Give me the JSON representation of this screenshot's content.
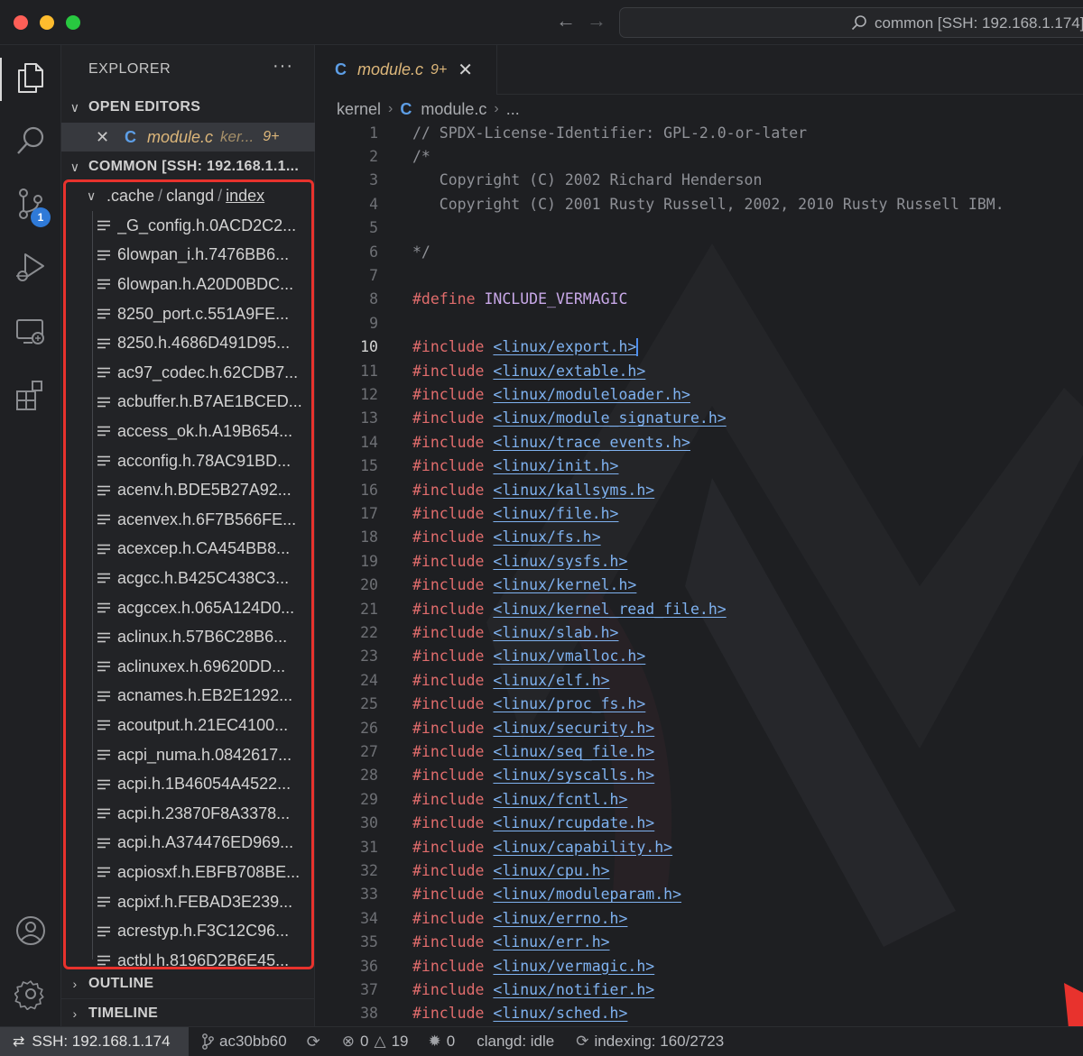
{
  "window": {
    "command_center_text": "common [SSH: 192.168.1.174]"
  },
  "activity_bar": {
    "source_control_badge": "1"
  },
  "sidebar": {
    "title": "EXPLORER",
    "more_label": "···",
    "open_editors_header": "OPEN EDITORS",
    "open_editor": {
      "name": "module.c",
      "path": "ker...",
      "badge": "9+"
    },
    "workspace_header": "COMMON [SSH: 192.168.1.1...",
    "folder_path": [
      ".cache",
      "clangd",
      "index"
    ],
    "files": [
      "_G_config.h.0ACD2C2...",
      "6lowpan_i.h.7476BB6...",
      "6lowpan.h.A20D0BDC...",
      "8250_port.c.551A9FE...",
      "8250.h.4686D491D95...",
      "ac97_codec.h.62CDB7...",
      "acbuffer.h.B7AE1BCED...",
      "access_ok.h.A19B654...",
      "acconfig.h.78AC91BD...",
      "acenv.h.BDE5B27A92...",
      "acenvex.h.6F7B566FE...",
      "acexcep.h.CA454BB8...",
      "acgcc.h.B425C438C3...",
      "acgccex.h.065A124D0...",
      "aclinux.h.57B6C28B6...",
      "aclinuxex.h.69620DD...",
      "acnames.h.EB2E1292...",
      "acoutput.h.21EC4100...",
      "acpi_numa.h.0842617...",
      "acpi.h.1B46054A4522...",
      "acpi.h.23870F8A3378...",
      "acpi.h.A374476ED969...",
      "acpiosxf.h.EBFB708BE...",
      "acpixf.h.FEBAD3E239...",
      "acrestyp.h.F3C12C96...",
      "actbl.h.8196D2B6E45..."
    ],
    "outline_header": "OUTLINE",
    "timeline_header": "TIMELINE"
  },
  "editor": {
    "tab": {
      "name": "module.c",
      "badge": "9+"
    },
    "breadcrumbs": [
      "kernel",
      "module.c",
      "..."
    ],
    "current_line": 10,
    "lines": [
      {
        "n": "1",
        "type": "comment",
        "text": "// SPDX-License-Identifier: GPL-2.0-or-later"
      },
      {
        "n": "2",
        "type": "comment",
        "text": "/*"
      },
      {
        "n": "3",
        "type": "comment",
        "text": "   Copyright (C) 2002 Richard Henderson"
      },
      {
        "n": "4",
        "type": "comment",
        "text": "   Copyright (C) 2001 Rusty Russell, 2002, 2010 Rusty Russell IBM."
      },
      {
        "n": "5",
        "type": "comment",
        "text": ""
      },
      {
        "n": "6",
        "type": "comment",
        "text": "*/"
      },
      {
        "n": "7",
        "type": "blank",
        "text": ""
      },
      {
        "n": "8",
        "type": "define",
        "kw": "#define",
        "text": "INCLUDE_VERMAGIC"
      },
      {
        "n": "9",
        "type": "blank",
        "text": ""
      },
      {
        "n": "10",
        "type": "include",
        "kw": "#include",
        "text": "<linux/export.h>"
      },
      {
        "n": "11",
        "type": "include",
        "kw": "#include",
        "text": "<linux/extable.h>"
      },
      {
        "n": "12",
        "type": "include",
        "kw": "#include",
        "text": "<linux/moduleloader.h>"
      },
      {
        "n": "13",
        "type": "include",
        "kw": "#include",
        "text": "<linux/module_signature.h>"
      },
      {
        "n": "14",
        "type": "include",
        "kw": "#include",
        "text": "<linux/trace_events.h>"
      },
      {
        "n": "15",
        "type": "include",
        "kw": "#include",
        "text": "<linux/init.h>"
      },
      {
        "n": "16",
        "type": "include",
        "kw": "#include",
        "text": "<linux/kallsyms.h>"
      },
      {
        "n": "17",
        "type": "include",
        "kw": "#include",
        "text": "<linux/file.h>"
      },
      {
        "n": "18",
        "type": "include",
        "kw": "#include",
        "text": "<linux/fs.h>"
      },
      {
        "n": "19",
        "type": "include",
        "kw": "#include",
        "text": "<linux/sysfs.h>"
      },
      {
        "n": "20",
        "type": "include",
        "kw": "#include",
        "text": "<linux/kernel.h>"
      },
      {
        "n": "21",
        "type": "include",
        "kw": "#include",
        "text": "<linux/kernel_read_file.h>"
      },
      {
        "n": "22",
        "type": "include",
        "kw": "#include",
        "text": "<linux/slab.h>"
      },
      {
        "n": "23",
        "type": "include",
        "kw": "#include",
        "text": "<linux/vmalloc.h>"
      },
      {
        "n": "24",
        "type": "include",
        "kw": "#include",
        "text": "<linux/elf.h>"
      },
      {
        "n": "25",
        "type": "include",
        "kw": "#include",
        "text": "<linux/proc_fs.h>"
      },
      {
        "n": "26",
        "type": "include",
        "kw": "#include",
        "text": "<linux/security.h>"
      },
      {
        "n": "27",
        "type": "include",
        "kw": "#include",
        "text": "<linux/seq_file.h>"
      },
      {
        "n": "28",
        "type": "include",
        "kw": "#include",
        "text": "<linux/syscalls.h>"
      },
      {
        "n": "29",
        "type": "include",
        "kw": "#include",
        "text": "<linux/fcntl.h>"
      },
      {
        "n": "30",
        "type": "include",
        "kw": "#include",
        "text": "<linux/rcupdate.h>"
      },
      {
        "n": "31",
        "type": "include",
        "kw": "#include",
        "text": "<linux/capability.h>"
      },
      {
        "n": "32",
        "type": "include",
        "kw": "#include",
        "text": "<linux/cpu.h>"
      },
      {
        "n": "33",
        "type": "include",
        "kw": "#include",
        "text": "<linux/moduleparam.h>"
      },
      {
        "n": "34",
        "type": "include",
        "kw": "#include",
        "text": "<linux/errno.h>"
      },
      {
        "n": "35",
        "type": "include",
        "kw": "#include",
        "text": "<linux/err.h>"
      },
      {
        "n": "36",
        "type": "include",
        "kw": "#include",
        "text": "<linux/vermagic.h>"
      },
      {
        "n": "37",
        "type": "include",
        "kw": "#include",
        "text": "<linux/notifier.h>"
      },
      {
        "n": "38",
        "type": "include",
        "kw": "#include",
        "text": "<linux/sched.h>"
      }
    ]
  },
  "status_bar": {
    "remote": "SSH: 192.168.1.174",
    "branch": "ac30bb60",
    "errors": "0",
    "warnings": "19",
    "ports": "0",
    "clangd": "clangd: idle",
    "indexing": "indexing: 160/2723"
  },
  "colors": {
    "annotation_red": "#e8322d",
    "accent_blue": "#2f7ad8",
    "modified_yellow": "#dcb67a"
  }
}
